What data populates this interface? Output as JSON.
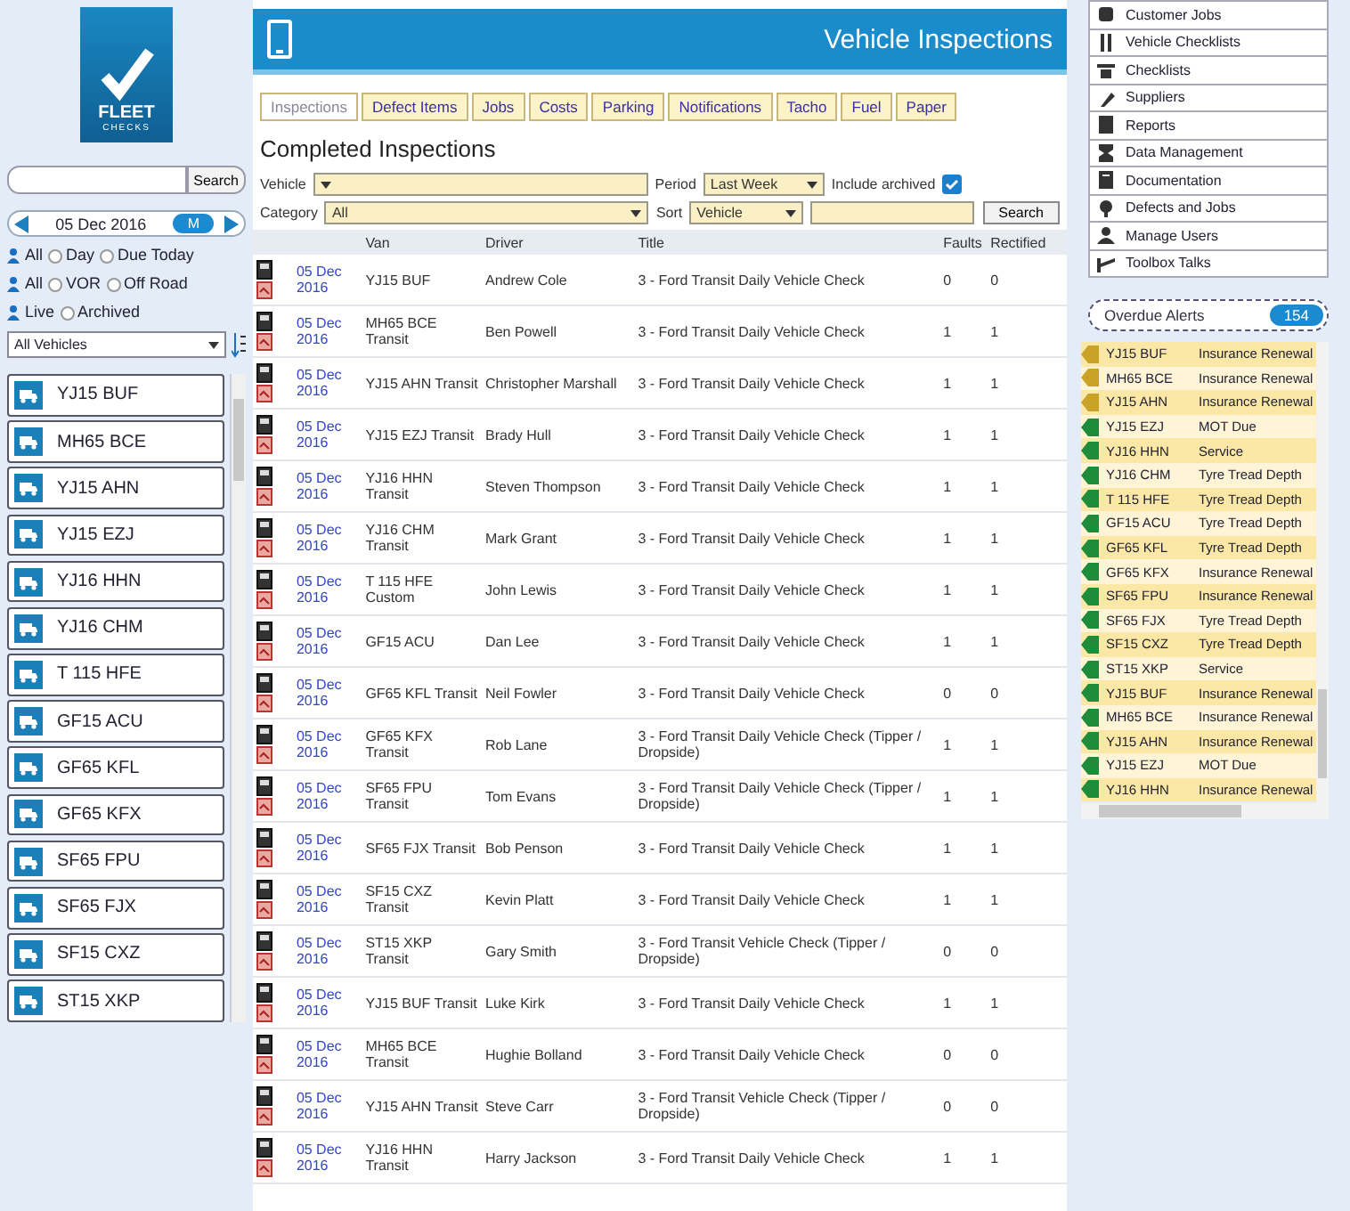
{
  "logo": {
    "title": "FLEET",
    "subtitle": "CHECKS"
  },
  "search": {
    "button": "Search"
  },
  "date_nav": {
    "label": "05 Dec 2016",
    "toggle": "M"
  },
  "radio_groups": [
    {
      "label": "All",
      "options": [
        {
          "label": "Day",
          "selected": false
        },
        {
          "label": "Due Today",
          "selected": false
        }
      ]
    },
    {
      "label": "All",
      "options": [
        {
          "label": "VOR",
          "selected": false
        },
        {
          "label": "Off Road",
          "selected": false
        }
      ]
    },
    {
      "label": "Live",
      "options": [
        {
          "label": "Archived",
          "selected": false
        }
      ]
    }
  ],
  "vehicle_filter": "All Vehicles",
  "vehicles": [
    "YJ15 BUF",
    "MH65 BCE",
    "YJ15 AHN",
    "YJ15 EZJ",
    "YJ16 HHN",
    "YJ16 CHM",
    "T 115 HFE",
    "GF15 ACU",
    "GF65 KFL",
    "GF65 KFX",
    "SF65 FPU",
    "SF65 FJX",
    "SF15 CXZ",
    "ST15 XKP"
  ],
  "header": {
    "title": "Vehicle Inspections"
  },
  "tabs": [
    {
      "label": "Inspections",
      "selected": true
    },
    {
      "label": "Defect Items",
      "selected": false
    },
    {
      "label": "Jobs",
      "selected": false
    },
    {
      "label": "Costs",
      "selected": false
    },
    {
      "label": "Parking",
      "selected": false
    },
    {
      "label": "Notifications",
      "selected": false
    },
    {
      "label": "Tacho",
      "selected": false
    },
    {
      "label": "Fuel",
      "selected": false
    },
    {
      "label": "Paper",
      "selected": false
    }
  ],
  "heading": "Completed Inspections",
  "filters": {
    "vehicle_label": "Vehicle",
    "period_label": "Period",
    "period": "Last Week",
    "archived_label": "Include archived",
    "archived": true,
    "category_label": "Category",
    "category": "All",
    "sort_label": "Sort",
    "sort": "Vehicle",
    "button": "Search"
  },
  "table": {
    "columns": [
      "Van",
      "Driver",
      "Title",
      "Faults",
      "Rectified"
    ],
    "rows": [
      {
        "date": "05 Dec 2016",
        "vehicle": "YJ15 BUF",
        "driver": "Andrew Cole",
        "title": "3 - Ford Transit Daily Vehicle Check",
        "faults": "0",
        "rectified": "0"
      },
      {
        "date": "05 Dec 2016",
        "vehicle": "MH65 BCE Transit",
        "driver": "Ben Powell",
        "title": "3 - Ford Transit Daily Vehicle Check",
        "faults": "1",
        "rectified": "1"
      },
      {
        "date": "05 Dec 2016",
        "vehicle": "YJ15 AHN Transit",
        "driver": "Christopher Marshall",
        "title": "3 - Ford Transit Daily Vehicle Check",
        "faults": "1",
        "rectified": "1"
      },
      {
        "date": "05 Dec 2016",
        "vehicle": "YJ15 EZJ Transit",
        "driver": "Brady Hull",
        "title": "3 - Ford Transit Daily Vehicle Check",
        "faults": "1",
        "rectified": "1"
      },
      {
        "date": "05 Dec 2016",
        "vehicle": "YJ16 HHN Transit",
        "driver": "Steven Thompson",
        "title": "3 - Ford Transit Daily Vehicle Check",
        "faults": "1",
        "rectified": "1"
      },
      {
        "date": "05 Dec 2016",
        "vehicle": "YJ16 CHM Transit",
        "driver": "Mark Grant",
        "title": "3 - Ford Transit Daily Vehicle Check",
        "faults": "1",
        "rectified": "1"
      },
      {
        "date": "05 Dec 2016",
        "vehicle": "T 115 HFE Custom",
        "driver": "John Lewis",
        "title": "3 - Ford Transit Daily Vehicle Check",
        "faults": "1",
        "rectified": "1"
      },
      {
        "date": "05 Dec 2016",
        "vehicle": "GF15 ACU",
        "driver": "Dan Lee",
        "title": "3 - Ford Transit Daily Vehicle Check",
        "faults": "1",
        "rectified": "1"
      },
      {
        "date": "05 Dec 2016",
        "vehicle": "GF65 KFL Transit",
        "driver": "Neil Fowler",
        "title": "3 - Ford Transit Daily Vehicle Check",
        "faults": "0",
        "rectified": "0"
      },
      {
        "date": "05 Dec 2016",
        "vehicle": "GF65 KFX Transit",
        "driver": "Rob Lane",
        "title": "3 - Ford Transit Daily Vehicle Check (Tipper / Dropside)",
        "faults": "1",
        "rectified": "1"
      },
      {
        "date": "05 Dec 2016",
        "vehicle": "SF65 FPU Transit",
        "driver": "Tom Evans",
        "title": "3 - Ford Transit Daily Vehicle Check (Tipper / Dropside)",
        "faults": "1",
        "rectified": "1"
      },
      {
        "date": "05 Dec 2016",
        "vehicle": "SF65 FJX Transit",
        "driver": "Bob Penson",
        "title": "3 - Ford Transit Daily Vehicle Check",
        "faults": "1",
        "rectified": "1"
      },
      {
        "date": "05 Dec 2016",
        "vehicle": "SF15 CXZ Transit",
        "driver": "Kevin Platt",
        "title": "3 - Ford Transit Daily Vehicle Check",
        "faults": "1",
        "rectified": "1"
      },
      {
        "date": "05 Dec 2016",
        "vehicle": "ST15 XKP Transit",
        "driver": "Gary Smith",
        "title": "3 - Ford Transit Vehicle Check (Tipper / Dropside)",
        "faults": "0",
        "rectified": "0"
      },
      {
        "date": "05 Dec 2016",
        "vehicle": "YJ15 BUF Transit",
        "driver": "Luke Kirk",
        "title": "3 - Ford Transit Daily Vehicle Check",
        "faults": "1",
        "rectified": "1"
      },
      {
        "date": "05 Dec 2016",
        "vehicle": "MH65 BCE Transit",
        "driver": "Hughie Bolland",
        "title": "3 - Ford Transit Daily Vehicle Check",
        "faults": "0",
        "rectified": "0"
      },
      {
        "date": "05 Dec 2016",
        "vehicle": "YJ15 AHN Transit",
        "driver": "Steve Carr",
        "title": "3 - Ford Transit Vehicle Check (Tipper / Dropside)",
        "faults": "0",
        "rectified": "0"
      },
      {
        "date": "05 Dec 2016",
        "vehicle": "YJ16 HHN Transit",
        "driver": "Harry Jackson",
        "title": "3 - Ford Transit Daily Vehicle Check",
        "faults": "1",
        "rectified": "1"
      }
    ]
  },
  "menu": [
    "Customer Jobs",
    "Vehicle Checklists",
    "Checklists",
    "Suppliers",
    "Reports",
    "Data Management",
    "Documentation",
    "Defects and Jobs",
    "Manage Users",
    "Toolbox Talks"
  ],
  "alerts_button": {
    "label": "Overdue Alerts",
    "count": "154"
  },
  "alerts": [
    {
      "reg": "YJ15 BUF",
      "text": "Insurance Renewal",
      "color": "#c9a227"
    },
    {
      "reg": "MH65 BCE",
      "text": "Insurance Renewal",
      "color": "#c9a227"
    },
    {
      "reg": "YJ15 AHN",
      "text": "Insurance Renewal",
      "color": "#c9a227"
    },
    {
      "reg": "YJ15 EZJ",
      "text": "MOT Due",
      "color": "#1e8c3a"
    },
    {
      "reg": "YJ16 HHN",
      "text": "Service",
      "color": "#1e8c3a"
    },
    {
      "reg": "YJ16 CHM",
      "text": "Tyre Tread Depth",
      "color": "#1e8c3a"
    },
    {
      "reg": "T 115 HFE",
      "text": "Tyre Tread Depth",
      "color": "#1e8c3a"
    },
    {
      "reg": "GF15 ACU",
      "text": "Tyre Tread Depth",
      "color": "#1e8c3a"
    },
    {
      "reg": "GF65 KFL",
      "text": "Tyre Tread Depth",
      "color": "#1e8c3a"
    },
    {
      "reg": "GF65 KFX",
      "text": "Insurance Renewal",
      "color": "#1e8c3a"
    },
    {
      "reg": "SF65 FPU",
      "text": "Insurance Renewal",
      "color": "#1e8c3a"
    },
    {
      "reg": "SF65 FJX",
      "text": "Tyre Tread Depth",
      "color": "#1e8c3a"
    },
    {
      "reg": "SF15 CXZ",
      "text": "Tyre Tread Depth",
      "color": "#1e8c3a"
    },
    {
      "reg": "ST15 XKP",
      "text": "Service",
      "color": "#1e8c3a"
    },
    {
      "reg": "YJ15 BUF",
      "text": "Insurance Renewal",
      "color": "#1e8c3a"
    },
    {
      "reg": "MH65 BCE",
      "text": "Insurance Renewal",
      "color": "#1e8c3a"
    },
    {
      "reg": "YJ15 AHN",
      "text": "Insurance Renewal",
      "color": "#1e8c3a"
    },
    {
      "reg": "YJ15 EZJ",
      "text": "MOT Due",
      "color": "#1e8c3a"
    },
    {
      "reg": "YJ16 HHN",
      "text": "Insurance Renewal",
      "color": "#1e8c3a"
    }
  ]
}
